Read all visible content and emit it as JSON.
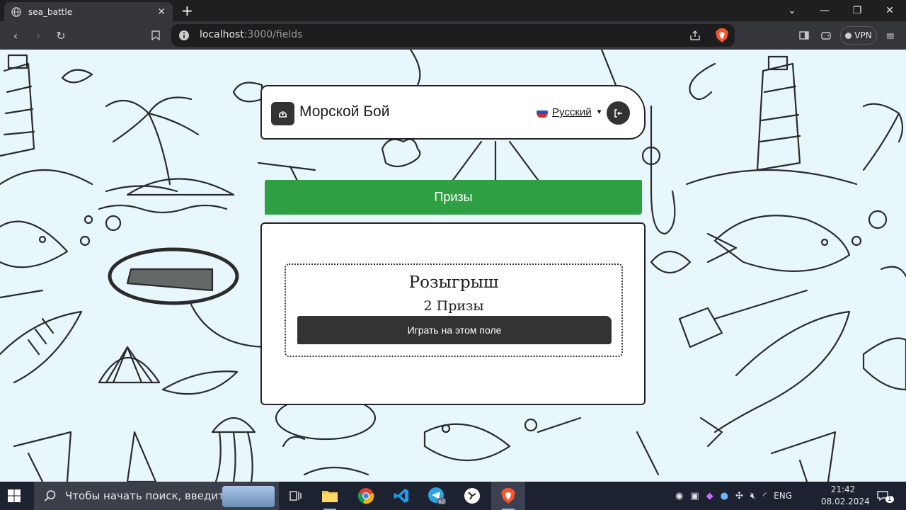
{
  "browser": {
    "tab_title": "sea_battle",
    "url_host": "localhost",
    "url_path": ":3000/fields",
    "vpn_label": "VPN"
  },
  "header": {
    "title": "Морской Бой",
    "language": "Русский"
  },
  "prizes_button": "Призы",
  "raffle": {
    "title": "Розыгрыш",
    "count": "2",
    "count_label": "Призы",
    "play_button": "Играть на этом поле"
  },
  "taskbar": {
    "search_placeholder": "Чтобы начать поиск, введите",
    "language": "ENG",
    "time": "21:42",
    "date": "08.02.2024",
    "notification_count": "1",
    "telegram_badge": "62"
  },
  "colors": {
    "accent_green": "#2ea043",
    "dark": "#333333",
    "page_bg": "#e8f7fc"
  }
}
